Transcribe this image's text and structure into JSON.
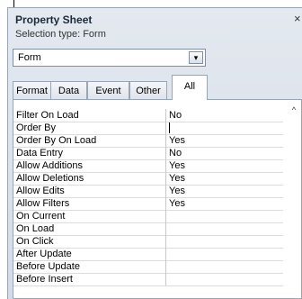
{
  "panel": {
    "title": "Property Sheet",
    "close_icon_glyph": "×",
    "selection_type": "Selection type:  Form",
    "selector_value": "Form",
    "selector_dropdown_glyph": "▾"
  },
  "tabs": [
    {
      "label": "Format"
    },
    {
      "label": "Data"
    },
    {
      "label": "Event"
    },
    {
      "label": "Other"
    },
    {
      "label": "All",
      "active": true
    }
  ],
  "properties": [
    {
      "name": "Filter On Load",
      "value": "No"
    },
    {
      "name": "Order By",
      "value": ""
    },
    {
      "name": "Order By On Load",
      "value": "Yes"
    },
    {
      "name": "Data Entry",
      "value": "No"
    },
    {
      "name": "Allow Additions",
      "value": "Yes"
    },
    {
      "name": "Allow Deletions",
      "value": "Yes"
    },
    {
      "name": "Allow Edits",
      "value": "Yes"
    },
    {
      "name": "Allow Filters",
      "value": "Yes"
    },
    {
      "name": "On Current",
      "value": ""
    },
    {
      "name": "On Load",
      "value": ""
    },
    {
      "name": "On Click",
      "value": ""
    },
    {
      "name": "After Update",
      "value": ""
    },
    {
      "name": "Before Update",
      "value": ""
    },
    {
      "name": "Before Insert",
      "value": ""
    }
  ],
  "scrollbar": {
    "up_glyph": "^"
  }
}
